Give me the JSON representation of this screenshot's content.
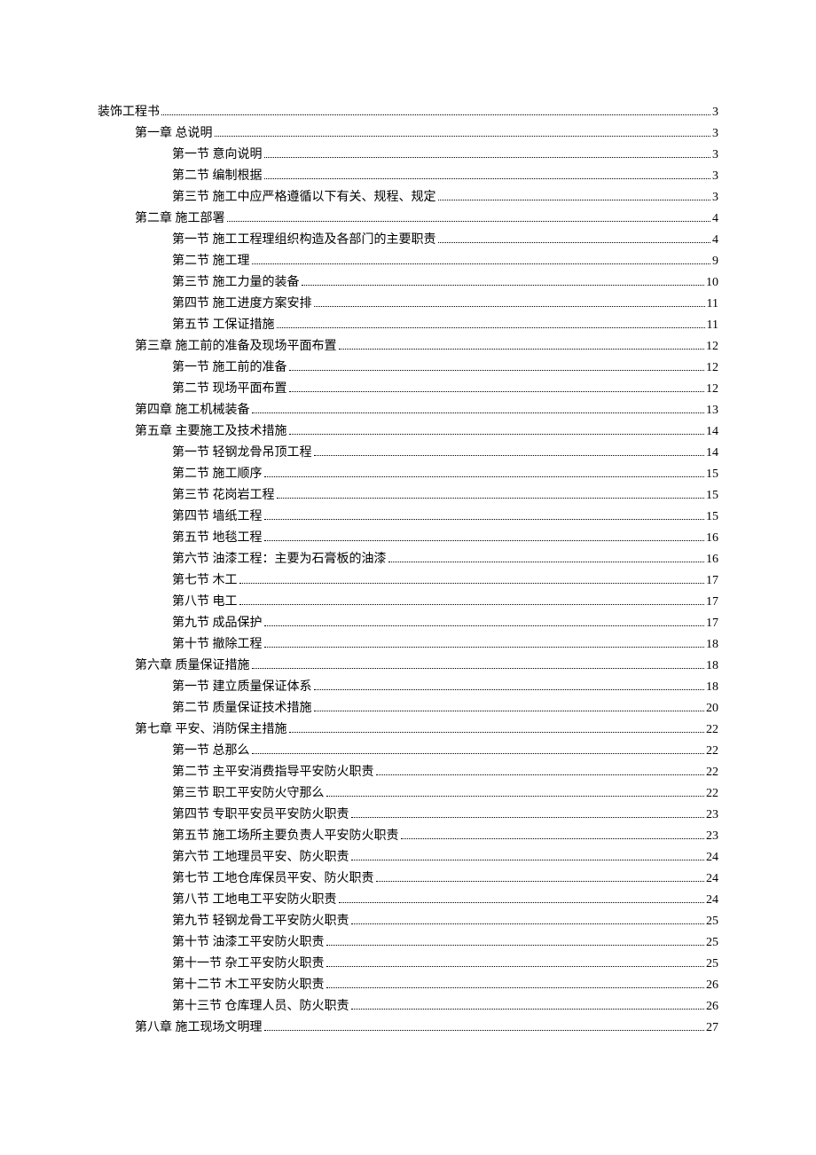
{
  "toc": [
    {
      "level": 0,
      "label": "装饰工程书",
      "page": "3"
    },
    {
      "level": 1,
      "label": "第一章  总说明",
      "page": "3"
    },
    {
      "level": 2,
      "label": "第一节  意向说明",
      "page": "3"
    },
    {
      "level": 2,
      "label": "第二节  编制根据",
      "page": "3"
    },
    {
      "level": 2,
      "label": "第三节  施工中应严格遵循以下有关、规程、规定",
      "page": "3"
    },
    {
      "level": 1,
      "label": "第二章  施工部署",
      "page": "4"
    },
    {
      "level": 2,
      "label": "第一节  施工工程理组织构造及各部门的主要职责",
      "page": "4"
    },
    {
      "level": 2,
      "label": "第二节  施工理",
      "page": "9"
    },
    {
      "level": 2,
      "label": "第三节  施工力量的装备",
      "page": "10"
    },
    {
      "level": 2,
      "label": "第四节  施工进度方案安排",
      "page": "11"
    },
    {
      "level": 2,
      "label": "第五节  工保证措施",
      "page": "11"
    },
    {
      "level": 1,
      "label": "第三章  施工前的准备及现场平面布置",
      "page": "12"
    },
    {
      "level": 2,
      "label": "第一节  施工前的准备",
      "page": "12"
    },
    {
      "level": 2,
      "label": "第二节  现场平面布置",
      "page": "12"
    },
    {
      "level": 1,
      "label": "第四章  施工机械装备",
      "page": "13"
    },
    {
      "level": 1,
      "label": "第五章  主要施工及技术措施",
      "page": "14"
    },
    {
      "level": 2,
      "label": "第一节  轻钢龙骨吊顶工程",
      "page": "14"
    },
    {
      "level": 2,
      "label": "第二节  施工顺序",
      "page": "15"
    },
    {
      "level": 2,
      "label": "第三节  花岗岩工程",
      "page": "15"
    },
    {
      "level": 2,
      "label": "第四节  墙纸工程",
      "page": "15"
    },
    {
      "level": 2,
      "label": "第五节  地毯工程",
      "page": "16"
    },
    {
      "level": 2,
      "label": "第六节  油漆工程：主要为石膏板的油漆",
      "page": "16"
    },
    {
      "level": 2,
      "label": "第七节  木工",
      "page": "17"
    },
    {
      "level": 2,
      "label": "第八节  电工",
      "page": "17"
    },
    {
      "level": 2,
      "label": "第九节  成品保护",
      "page": "17"
    },
    {
      "level": 2,
      "label": "第十节  撤除工程",
      "page": "18"
    },
    {
      "level": 1,
      "label": "第六章  质量保证措施",
      "page": "18"
    },
    {
      "level": 2,
      "label": "第一节  建立质量保证体系",
      "page": "18"
    },
    {
      "level": 2,
      "label": "第二节  质量保证技术措施",
      "page": "20"
    },
    {
      "level": 1,
      "label": "第七章  平安、消防保主措施",
      "page": "22"
    },
    {
      "level": 2,
      "label": "第一节  总那么",
      "page": "22"
    },
    {
      "level": 2,
      "label": "第二节  主平安消费指导平安防火职责",
      "page": "22"
    },
    {
      "level": 2,
      "label": "第三节  职工平安防火守那么",
      "page": "22"
    },
    {
      "level": 2,
      "label": "第四节  专职平安员平安防火职责",
      "page": "23"
    },
    {
      "level": 2,
      "label": "第五节  施工场所主要负责人平安防火职责",
      "page": "23"
    },
    {
      "level": 2,
      "label": "第六节  工地理员平安、防火职责",
      "page": "24"
    },
    {
      "level": 2,
      "label": "第七节  工地仓库保员平安、防火职责",
      "page": "24"
    },
    {
      "level": 2,
      "label": "第八节  工地电工平安防火职责",
      "page": "24"
    },
    {
      "level": 2,
      "label": "第九节  轻钢龙骨工平安防火职责",
      "page": "25"
    },
    {
      "level": 2,
      "label": "第十节  油漆工平安防火职责",
      "page": "25"
    },
    {
      "level": 2,
      "label": "第十一节  杂工平安防火职责",
      "page": "25"
    },
    {
      "level": 2,
      "label": "第十二节  木工平安防火职责",
      "page": "26"
    },
    {
      "level": 2,
      "label": "第十三节  仓库理人员、防火职责",
      "page": "26"
    },
    {
      "level": 1,
      "label": "第八章  施工现场文明理",
      "page": "27"
    }
  ]
}
